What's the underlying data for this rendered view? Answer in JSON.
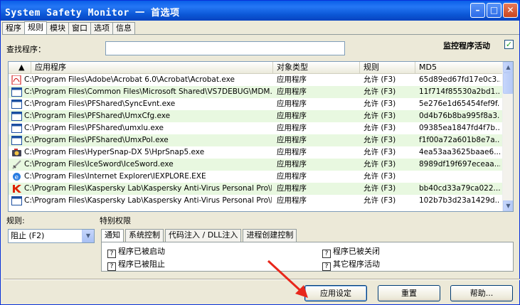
{
  "window": {
    "title": "System Safety Monitor 一 首选项"
  },
  "tabs": [
    {
      "label": "程序"
    },
    {
      "label": "规则"
    },
    {
      "label": "模块"
    },
    {
      "label": "窗口"
    },
    {
      "label": "选项"
    },
    {
      "label": "信息"
    }
  ],
  "search": {
    "label": "查找程序：",
    "value": ""
  },
  "monitor": {
    "label": "监控程序活动",
    "checked": true
  },
  "table": {
    "headers": [
      "应用程序",
      "对象类型",
      "规则",
      "MD5"
    ],
    "rows": [
      {
        "icon": "pdf-icon",
        "path": "C:\\Program Files\\Adobe\\Acrobat 6.0\\Acrobat\\Acrobat.exe",
        "type": "应用程序",
        "rule": "允许 (F3)",
        "md5": "65d89ed67fd17e0c3..."
      },
      {
        "icon": "window-icon",
        "path": "C:\\Program Files\\Common Files\\Microsoft Shared\\VS7DEBUG\\MDM.E...",
        "type": "应用程序",
        "rule": "允许 (F3)",
        "md5": "11f714f85530a2bd1..."
      },
      {
        "icon": "window-icon",
        "path": "C:\\Program Files\\PFShared\\SyncEvnt.exe",
        "type": "应用程序",
        "rule": "允许 (F3)",
        "md5": "5e276e1d65454fef9f..."
      },
      {
        "icon": "window-icon",
        "path": "C:\\Program Files\\PFShared\\UmxCfg.exe",
        "type": "应用程序",
        "rule": "允许 (F3)",
        "md5": "0d4b76b8ba995f8a3..."
      },
      {
        "icon": "window-icon",
        "path": "C:\\Program Files\\PFShared\\umxlu.exe",
        "type": "应用程序",
        "rule": "允许 (F3)",
        "md5": "09385ea1847fd4f7b..."
      },
      {
        "icon": "window-icon",
        "path": "C:\\Program Files\\PFShared\\UmxPol.exe",
        "type": "应用程序",
        "rule": "允许 (F3)",
        "md5": "f1f00a72a601b8e7a..."
      },
      {
        "icon": "camera-icon",
        "path": "C:\\Program Files\\HyperSnap-DX 5\\HprSnap5.exe",
        "type": "应用程序",
        "rule": "允许 (F3)",
        "md5": "4ea53aa3625baae6..."
      },
      {
        "icon": "sword-icon",
        "path": "C:\\Program Files\\IceSword\\IceSword.exe",
        "type": "应用程序",
        "rule": "允许 (F3)",
        "md5": "8989df19f697eceaa..."
      },
      {
        "icon": "ie-icon",
        "path": "C:\\Program Files\\Internet Explorer\\IEXPLORE.EXE",
        "type": "应用程序",
        "rule": "允许 (F3)",
        "md5": ""
      },
      {
        "icon": "kaspersky-icon",
        "path": "C:\\Program Files\\Kaspersky Lab\\Kaspersky Anti-Virus Personal Pro\\ka...",
        "type": "应用程序",
        "rule": "允许 (F3)",
        "md5": "bb40cd33a79ca022..."
      },
      {
        "icon": "window-icon",
        "path": "C:\\Program Files\\Kaspersky Lab\\Kaspersky Anti-Virus Personal Pro\\ka...",
        "type": "应用程序",
        "rule": "允许 (F3)",
        "md5": "102b7b3d23a1429d..."
      }
    ]
  },
  "rule": {
    "label": "规则:",
    "selected": "阻止 (F2)"
  },
  "permissions": {
    "label": "特别权限",
    "tabs": [
      "通知",
      "系统控制",
      "代码注入 / DLL注入",
      "进程创建控制"
    ],
    "items": [
      "程序已被启动",
      "程序已被阻止",
      "程序已被关闭",
      "其它程序活动"
    ]
  },
  "buttons": {
    "apply": "应用设定",
    "reset": "重置",
    "help": "帮助..."
  },
  "colors": {
    "title_bar": "#0a5fe8",
    "row_alt": "#e8f8e0",
    "accent": "#e8271b"
  }
}
